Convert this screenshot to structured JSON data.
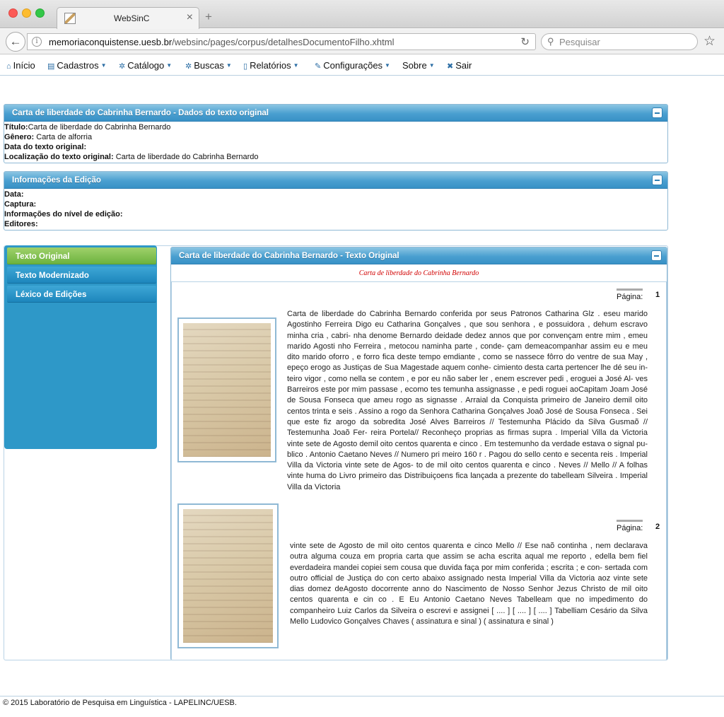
{
  "browser": {
    "tab_title": "WebSinC",
    "url_host": "memoriaconquistense.uesb.br",
    "url_path": "/websinc/pages/corpus/detalhesDocumentoFilho.xhtml",
    "search_placeholder": "Pesquisar"
  },
  "menu": [
    {
      "label": "Início",
      "icon": "home-icon"
    },
    {
      "label": "Cadastros",
      "icon": "table-icon"
    },
    {
      "label": "Catálogo",
      "icon": "gear-icon"
    },
    {
      "label": "Buscas",
      "icon": "gear-icon"
    },
    {
      "label": "Relatórios",
      "icon": "document-icon"
    },
    {
      "label": "Configurações",
      "icon": "wrench-icon"
    },
    {
      "label": "Sobre",
      "icon": ""
    },
    {
      "label": "Sair",
      "icon": "close-icon"
    }
  ],
  "original_panel": {
    "title": "Carta de liberdade do Cabrinha Bernardo - Dados do texto original",
    "titulo_label": "Título:",
    "titulo_value": "Carta de liberdade do Cabrinha Bernardo",
    "genero_label": "Gênero:",
    "genero_value": "Carta de alforria",
    "data_label": "Data do texto original:",
    "data_value": "",
    "local_label": "Localização do texto original:",
    "local_value": "Carta de liberdade do Cabrinha Bernardo"
  },
  "edition_panel": {
    "title": "Informações da Edição",
    "data_label": "Data:",
    "captura_label": "Captura:",
    "nivel_label": "Informações do nível de edição:",
    "editores_label": "Editores:"
  },
  "sidebar": {
    "items": [
      "Texto Original",
      "Texto Modernizado",
      "Léxico de Edições"
    ],
    "active_color": "#7ab847",
    "color": "#2e98c8"
  },
  "text_panel": {
    "title": "Carta de liberdade do Cabrinha Bernardo - Texto Original",
    "doc_link": "Carta de liberdade do Cabrinha Bernardo",
    "page_label": "Página:",
    "pages": [
      {
        "number": "1",
        "text": "Carta de liberdade do Cabrinha Bernardo conferida por seus Patronos Catharina Glz . eseu marido Agostinho Ferreira Digo eu Catharina Gonçalves , que sou senhora , e possuidora , dehum escravo minha cria , cabri- nha denome Bernardo deidade dedez annos que por convençam entre mim , emeu marido Agosti nho Ferreira , metocou naminha parte , conde- çam demeacompanhar assim eu e meu dito marido oforro , e forro fica deste tempo emdiante , como se nassece fôrro do ventre de sua May , epeço erogo as Justiças de Sua Magestade aquem conhe- cimiento desta carta pertencer lhe dé seu in- teiro vigor , como nella se contem , e por eu não saber ler , enem escrever pedi , eroguei a José Al- ves Barreiros este por mim passase , ecomo tes temunha assignasse , e pedi roguei aoCapitam Joam José de Sousa Fonseca que ameu rogo as signasse . Arraial da Conquista primeiro de Janeiro demil oito centos trinta e seis . Assino a rogo da Senhora Catharina Gonçalves Joaõ José de Sousa Fonseca . Sei que este fiz arogo da sobredita José Alves Barreiros // Testemunha Plácido da Silva Gusmaõ // Testemunha Joaõ Fer- reira Portela// Reconheço proprias as firmas supra . Imperial Villa da Victoria vinte sete de Agosto demil oito centos quarenta e cinco . Em testemunho da verdade estava o signal pu- blico . Antonio Caetano Neves // Numero pri meiro 160 r . Pagou do sello cento e secenta reis . Imperial Villa da Victoria vinte sete de Agos- to de mil oito centos quarenta e cinco . Neves // Mello // A folhas vinte huma do Livro primeiro das Distribuiçoens fica lançada a prezente do tabelleam Silveira . Imperial Villa da Victoria"
      },
      {
        "number": "2",
        "text": "vinte sete de Agosto de mil oito centos quarenta e cinco Mello // Ese naõ continha , nem declarava outra alguma couza em propria carta que assim se acha escrita aqual me reporto , edella bem fiel everdadeira mandei copiei sem cousa que duvida faça por mim conferida ; escrita ; e con- sertada com outro official de Justiça do con certo abaixo assignado nesta Imperial Villa da Victoria aoz vinte sete dias domez deAgosto docorrente anno do Nascimento de Nosso Senhor Jezus Christo de mil oito centos quarenta e cin co . E Eu Antonio Caetano Neves Tabelleam que no impedimento do companheiro Luiz Carlos da Silveira o escrevi e assignei [ .... ] [ .... ] [ .... ] Tabelliam Cesário da Silva Mello Ludovico Gonçalves Chaves ( assinatura e sinal ) ( assinatura e sinal )"
      }
    ]
  },
  "footer": "© 2015 Laboratório de Pesquisa em Linguística - LAPELINC/UESB.",
  "colors": {
    "header_blue": "#4a9fd0",
    "link_red": "#d10000"
  }
}
